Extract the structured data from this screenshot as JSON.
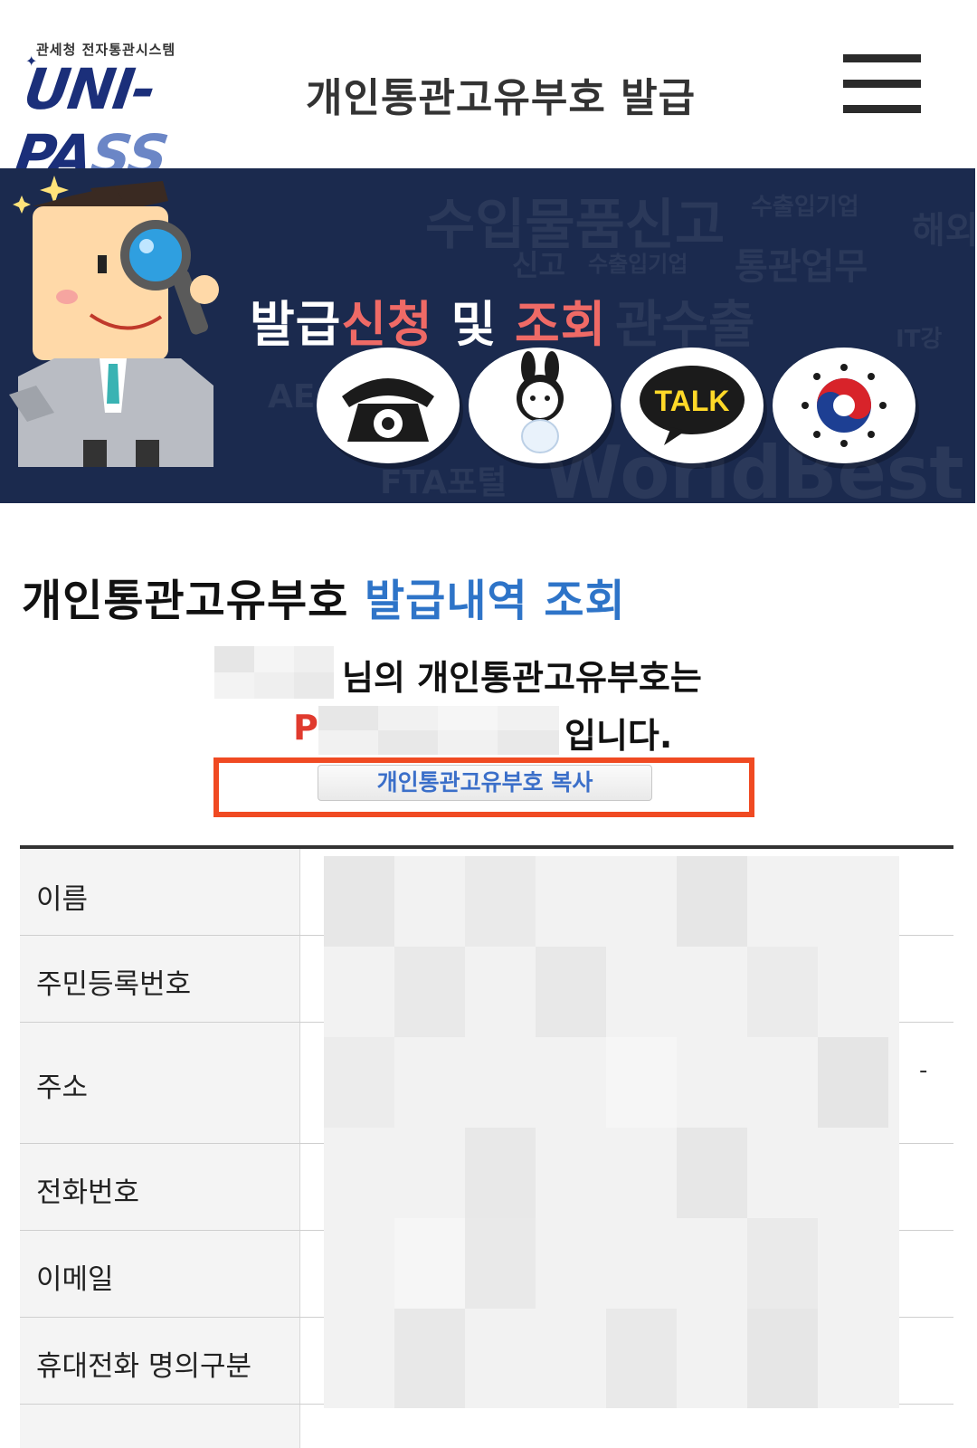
{
  "header": {
    "logo_sub": "관세청 전자통관시스템",
    "logo_main": "UNI-PA",
    "logo_main_fade": "SS",
    "title": "개인통관고유부호 발급",
    "menu_icon": "hamburger-menu-icon"
  },
  "banner": {
    "title_white_1": "발급",
    "title_red_1": "신청",
    "title_white_2": " 및 ",
    "title_red_2": "조회",
    "bg_words": [
      "수입물품신고",
      "수출입기업",
      "해외",
      "신고",
      "수출입기업",
      "통관업무",
      "관수출",
      "WorldBest",
      "FTA포털",
      "AEO",
      "IT강"
    ],
    "buttons": [
      {
        "icon": "telephone-icon"
      },
      {
        "icon": "mascot-rabbit-icon"
      },
      {
        "icon": "kakao-talk-icon",
        "label": "TALK"
      },
      {
        "icon": "government-emblem-icon"
      }
    ],
    "colors": {
      "background": "#1b2a4e",
      "accent_red": "#ef6a66"
    }
  },
  "section": {
    "title_black": "개인통관고유부호 ",
    "title_blue": "발급내역 조회",
    "accent_blue": "#2e74c8"
  },
  "result": {
    "line1_suffix": "님의 개인통관고유부호는",
    "code_prefix": "P",
    "line2_suffix": "입니다.",
    "copy_button": "개인통관고유부호 복사",
    "highlight_color": "#f04a22"
  },
  "table": {
    "rows": [
      {
        "label": "이름"
      },
      {
        "label": "주민등록번호"
      },
      {
        "label": "주소"
      },
      {
        "label": "전화번호"
      },
      {
        "label": "이메일"
      },
      {
        "label": "휴대전화 명의구분"
      }
    ],
    "address_trailing_mark": "-"
  }
}
